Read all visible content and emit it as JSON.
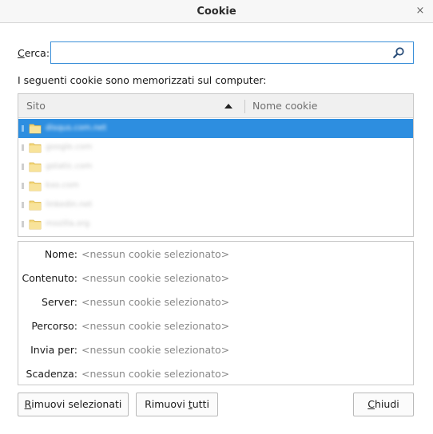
{
  "window": {
    "title": "Cookie",
    "close_glyph": "×"
  },
  "search": {
    "label_first": "C",
    "label_rest": "erca:",
    "value": "",
    "placeholder": "",
    "icon": "search-icon"
  },
  "intro_text": "I seguenti cookie sono memorizzati sul computer:",
  "tree": {
    "columns": {
      "site": "Sito",
      "cookie_name": "Nome cookie"
    },
    "sort": "ascending",
    "rows": [
      {
        "host": "disqus.com.net",
        "selected": true
      },
      {
        "host": "google.com",
        "selected": false
      },
      {
        "host": "gstatic.com",
        "selected": false
      },
      {
        "host": "kxo.com",
        "selected": false
      },
      {
        "host": "linkedin.net",
        "selected": false
      },
      {
        "host": "mozilla.org",
        "selected": false
      }
    ]
  },
  "details": [
    {
      "label": "Nome:",
      "value": "<nessun cookie selezionato>"
    },
    {
      "label": "Contenuto:",
      "value": "<nessun cookie selezionato>"
    },
    {
      "label": "Server:",
      "value": "<nessun cookie selezionato>"
    },
    {
      "label": "Percorso:",
      "value": "<nessun cookie selezionato>"
    },
    {
      "label": "Invia per:",
      "value": "<nessun cookie selezionato>"
    },
    {
      "label": "Scadenza:",
      "value": "<nessun cookie selezionato>"
    }
  ],
  "buttons": {
    "remove_selected": {
      "key": "R",
      "rest": "imuovi selezionati"
    },
    "remove_all": {
      "pre": "Rimuovi ",
      "key": "t",
      "rest": "utti"
    },
    "close": {
      "key": "C",
      "rest": "hiudi"
    }
  },
  "colors": {
    "selection": "#2d8ee0",
    "focus_border": "#3a8fd8",
    "folder": "#f3d77a"
  }
}
